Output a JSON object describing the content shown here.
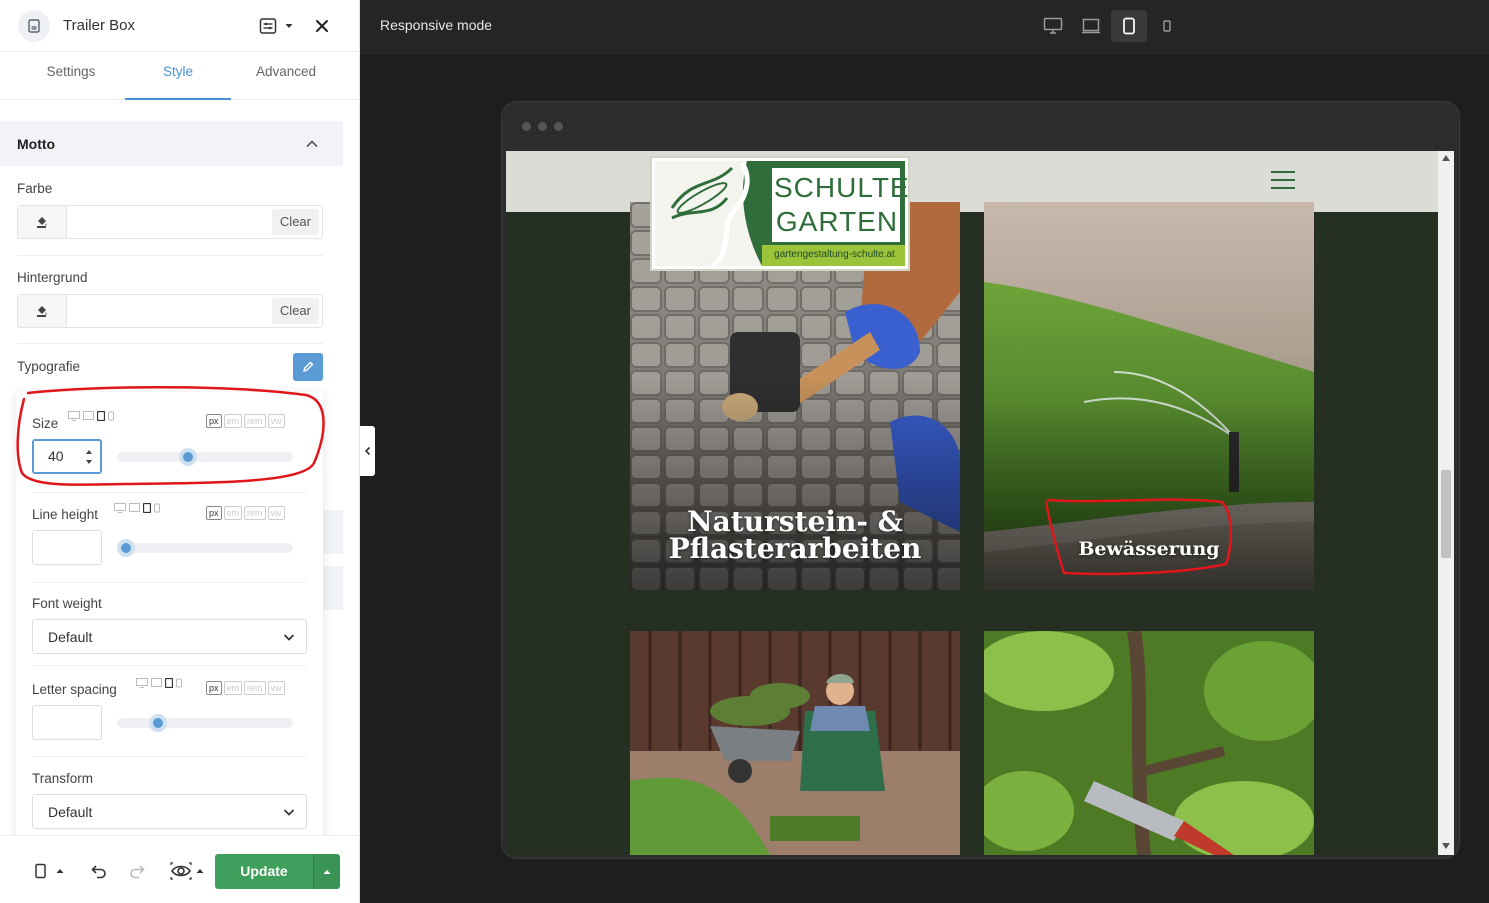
{
  "panel": {
    "title": "Trailer Box",
    "element_icon": "document-icon",
    "tabs": [
      "Settings",
      "Style",
      "Advanced"
    ],
    "active_tab": "Style"
  },
  "section": {
    "title": "Motto"
  },
  "fields": {
    "farbe_label": "Farbe",
    "hintergrund_label": "Hintergrund",
    "clear_label": "Clear",
    "typografie_label": "Typografie"
  },
  "typography": {
    "size_label": "Size",
    "size_value": "40",
    "size_slider_fraction": 0.39,
    "line_height_label": "Line height",
    "line_height_slider_fraction": 0.0,
    "font_weight_label": "Font weight",
    "font_weight_value": "Default",
    "letter_spacing_label": "Letter spacing",
    "letter_spacing_slider_fraction": 0.2,
    "transform_label": "Transform",
    "transform_value": "Default",
    "units": [
      "px",
      "em",
      "rem",
      "vw"
    ],
    "active_unit": "px"
  },
  "footer": {
    "update_label": "Update"
  },
  "preview": {
    "mode_label": "Responsive mode",
    "devices": [
      "desktop-icon",
      "laptop-icon",
      "tablet-icon",
      "mobile-icon"
    ],
    "active_device": "tablet-icon"
  },
  "site": {
    "logo_line1": "SCHULTE",
    "logo_line2": "GARTEN",
    "logo_url": "gartengestaltung-schulte.at",
    "tiles": [
      {
        "line1": "Naturstein- &",
        "line2": "Pflasterarbeiten"
      },
      {
        "line1": "Bewässerung",
        "line2": ""
      },
      {
        "line1": "",
        "line2": ""
      },
      {
        "line1": "",
        "line2": ""
      }
    ]
  },
  "colors": {
    "accent": "#5b9bd5",
    "update_green": "#3f9f5c",
    "site_bg": "#253023",
    "brand_green": "#2f6e3a",
    "annotation_red": "#e0161b"
  }
}
